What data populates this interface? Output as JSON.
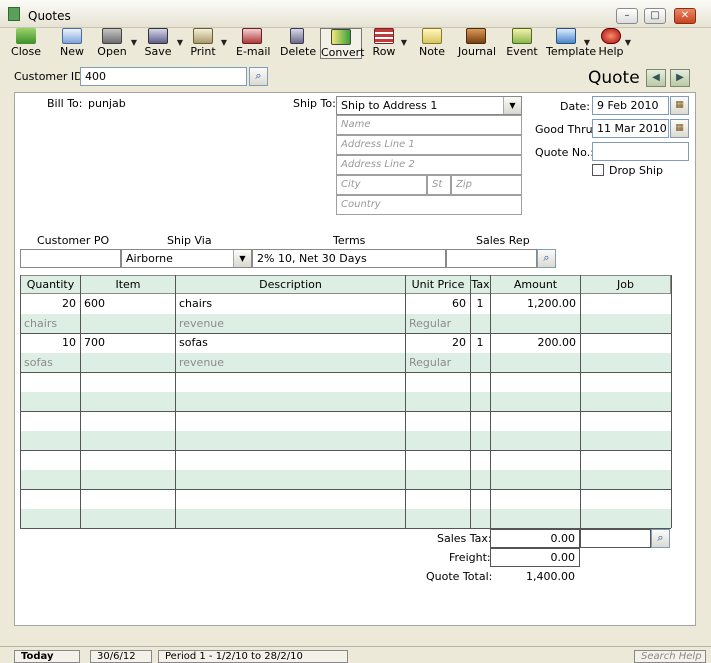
{
  "window": {
    "title": "Quotes",
    "minimize": "–",
    "maximize": "□",
    "close": "✕"
  },
  "toolbar": {
    "close": "Close",
    "new": "New",
    "open": "Open",
    "save": "Save",
    "print": "Print",
    "email": "E-mail",
    "delete": "Delete",
    "convert": "Convert",
    "row": "Row",
    "note": "Note",
    "journal": "Journal",
    "event": "Event",
    "template": "Template",
    "help": "Help",
    "dropdown_arrow": "▼"
  },
  "customer": {
    "label": "Customer ID:",
    "value": "400",
    "lookup_icon": "search-icon"
  },
  "heading": {
    "title": "Quote",
    "prev": "◀",
    "next": "▶"
  },
  "billto": {
    "label": "Bill To:",
    "value": "punjab"
  },
  "shipto": {
    "label": "Ship To:",
    "selected": "Ship to Address 1",
    "name_placeholder": "Name",
    "address1_placeholder": "Address Line 1",
    "address2_placeholder": "Address Line 2",
    "city_placeholder": "City",
    "state_placeholder": "St",
    "zip_placeholder": "Zip",
    "country_placeholder": "Country"
  },
  "dates": {
    "date_label": "Date:",
    "date_value": "9 Feb 2010",
    "good_thru_label": "Good Thru:",
    "good_thru_value": "11 Mar 2010",
    "quote_no_label": "Quote No.:",
    "quote_no_value": "",
    "drop_ship_label": "Drop Ship"
  },
  "terms_row": {
    "customer_po_label": "Customer PO",
    "ship_via_label": "Ship Via",
    "terms_label": "Terms",
    "sales_rep_label": "Sales Rep",
    "customer_po_value": "",
    "ship_via_value": "Airborne",
    "terms_value": "2% 10, Net 30 Days",
    "sales_rep_value": ""
  },
  "grid": {
    "headers": [
      "Quantity",
      "Item",
      "Description",
      "Unit Price",
      "Tax",
      "Amount",
      "Job"
    ],
    "rows": [
      {
        "quantity": "20",
        "item": "600",
        "description": "chairs",
        "unit_price": "60",
        "tax": "1",
        "amount": "1,200.00",
        "job": "",
        "sub_item": "chairs",
        "sub_desc": "revenue",
        "sub_price": "Regular"
      },
      {
        "quantity": "10",
        "item": "700",
        "description": "sofas",
        "unit_price": "20",
        "tax": "1",
        "amount": "200.00",
        "job": "",
        "sub_item": "sofas",
        "sub_desc": "revenue",
        "sub_price": "Regular"
      }
    ]
  },
  "totals": {
    "sales_tax_label": "Sales Tax:",
    "sales_tax_value": "0.00",
    "freight_label": "Freight:",
    "freight_value": "0.00",
    "quote_total_label": "Quote Total:",
    "quote_total_value": "1,400.00"
  },
  "statusbar": {
    "today": "Today",
    "date": "30/6/12",
    "period": "Period 1 - 1/2/10 to 28/2/10",
    "search_placeholder": "Search Help"
  },
  "colors": {
    "grid_band": "#ddeee4",
    "window_bg": "#ece9d8"
  }
}
